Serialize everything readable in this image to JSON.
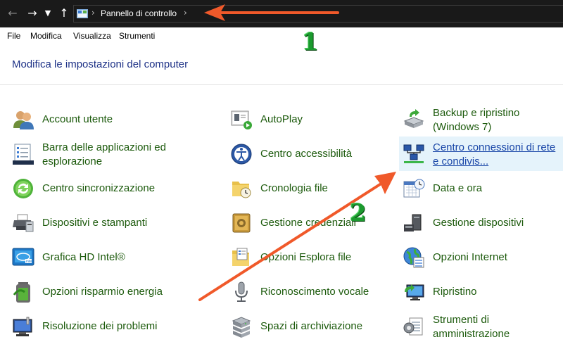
{
  "address_bar": {
    "path": "Pannello di controllo",
    "back_icon": "arrow-left-icon",
    "forward_icon": "arrow-right-icon",
    "recent_icon": "chevron-down-icon",
    "up_icon": "arrow-up-icon"
  },
  "menu": {
    "items": [
      {
        "label": "File"
      },
      {
        "label": "Modifica"
      },
      {
        "label": "Visualizza"
      },
      {
        "label": "Strumenti"
      }
    ]
  },
  "header": {
    "title": "Modifica le impostazioni del computer"
  },
  "control_panel": {
    "columns": [
      [
        {
          "line1": "Account utente",
          "line2": "",
          "icon": "users-icon"
        },
        {
          "line1": "Barra delle applicazioni ed",
          "line2": "esplorazione",
          "icon": "taskbar-icon"
        },
        {
          "line1": "Centro sincronizzazione",
          "line2": "",
          "icon": "sync-icon"
        },
        {
          "line1": "Dispositivi e stampanti",
          "line2": "",
          "icon": "printer-icon"
        },
        {
          "line1": "Grafica HD Intel®",
          "line2": "",
          "icon": "intel-graphics-icon"
        },
        {
          "line1": "Opzioni risparmio energia",
          "line2": "",
          "icon": "battery-icon"
        },
        {
          "line1": "Risoluzione dei problemi",
          "line2": "",
          "icon": "troubleshoot-monitor-icon"
        }
      ],
      [
        {
          "line1": "AutoPlay",
          "line2": "",
          "icon": "autoplay-icon"
        },
        {
          "line1": "Centro accessibilità",
          "line2": "",
          "icon": "accessibility-icon"
        },
        {
          "line1": "Cronologia file",
          "line2": "",
          "icon": "file-history-icon"
        },
        {
          "line1": "Gestione credenziali",
          "line2": "",
          "icon": "credential-vault-icon"
        },
        {
          "line1": "Opzioni Esplora file",
          "line2": "",
          "icon": "folder-options-icon"
        },
        {
          "line1": "Riconoscimento vocale",
          "line2": "",
          "icon": "microphone-icon"
        },
        {
          "line1": "Spazi di archiviazione",
          "line2": "",
          "icon": "storage-spaces-icon"
        }
      ],
      [
        {
          "line1": "Backup e ripristino",
          "line2": "(Windows 7)",
          "icon": "backup-icon"
        },
        {
          "line1": "Centro connessioni di rete",
          "line2": "e condivis...",
          "icon": "network-icon"
        },
        {
          "line1": "Data e ora",
          "line2": "",
          "icon": "calendar-clock-icon"
        },
        {
          "line1": "Gestione dispositivi",
          "line2": "",
          "icon": "device-manager-icon"
        },
        {
          "line1": "Opzioni Internet",
          "line2": "",
          "icon": "internet-globe-icon"
        },
        {
          "line1": "Ripristino",
          "line2": "",
          "icon": "recovery-icon"
        },
        {
          "line1": "Strumenti di",
          "line2": "amministrazione",
          "icon": "admin-tools-icon"
        }
      ]
    ]
  },
  "annotations": {
    "marker_1": "1",
    "marker_2": "2",
    "arrow_color": "#f0592a",
    "marker_color": "#1b9a2e"
  },
  "colors": {
    "item_link": "#1c5a0c",
    "title": "#1e3287",
    "highlight_bg": "#e5f3fb",
    "address_bar_bg": "#1a1a1a"
  }
}
